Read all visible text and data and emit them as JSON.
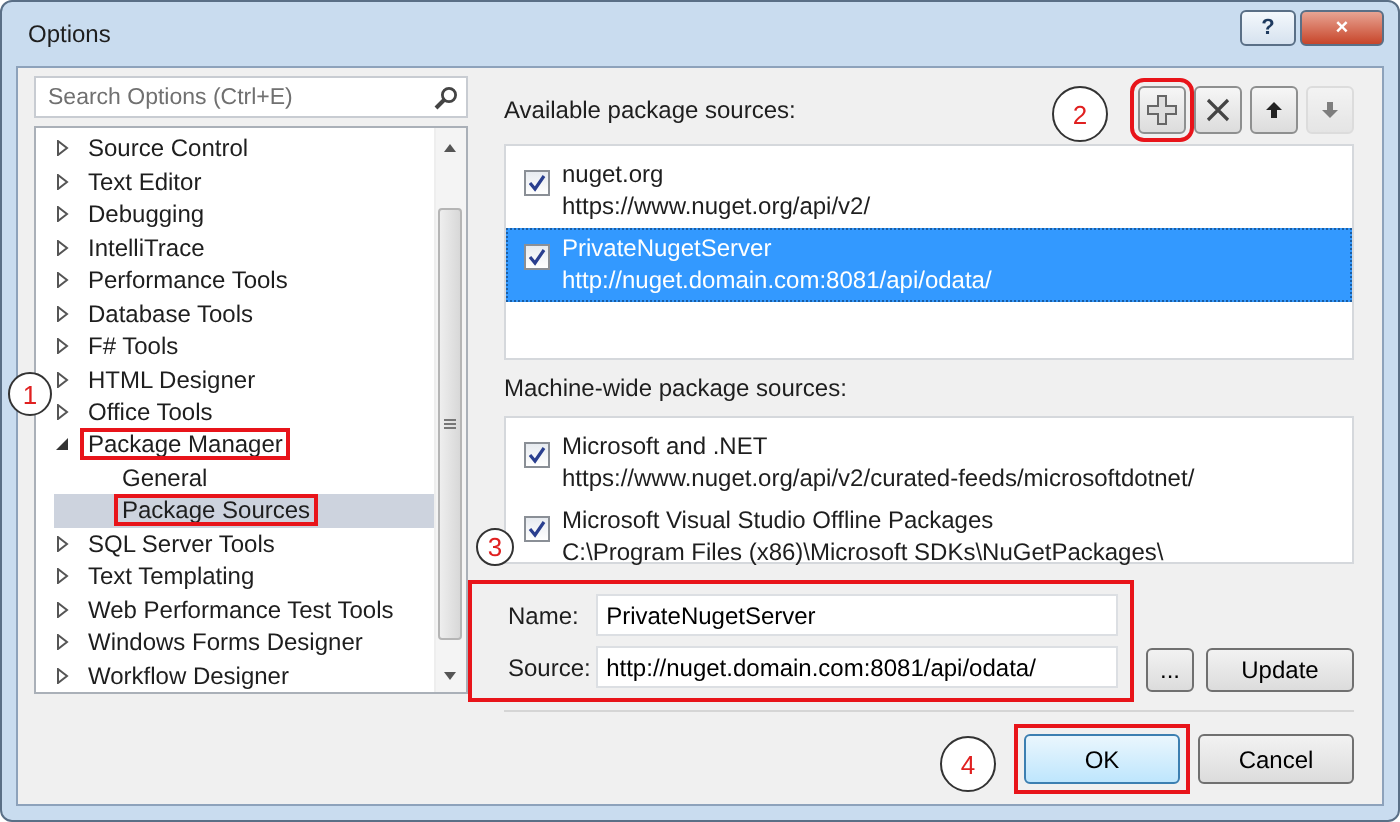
{
  "window": {
    "title": "Options",
    "buttons": [
      "?",
      "×"
    ]
  },
  "search": {
    "placeholder": "Search Options (Ctrl+E)"
  },
  "tree": [
    {
      "label": "Source Control",
      "expanded": false,
      "highlighted": false,
      "selected": false
    },
    {
      "label": "Text Editor",
      "expanded": false,
      "highlighted": false,
      "selected": false
    },
    {
      "label": "Debugging",
      "expanded": false,
      "highlighted": false,
      "selected": false
    },
    {
      "label": "IntelliTrace",
      "expanded": false,
      "highlighted": false,
      "selected": false
    },
    {
      "label": "Performance Tools",
      "expanded": false,
      "highlighted": false,
      "selected": false
    },
    {
      "label": "Database Tools",
      "expanded": false,
      "highlighted": false,
      "selected": false
    },
    {
      "label": "F# Tools",
      "expanded": false,
      "highlighted": false,
      "selected": false
    },
    {
      "label": "HTML Designer",
      "expanded": false,
      "highlighted": false,
      "selected": false
    },
    {
      "label": "Office Tools",
      "expanded": false,
      "highlighted": false,
      "selected": false
    },
    {
      "label": "Package Manager",
      "expanded": true,
      "highlighted": true,
      "selected": false,
      "children": [
        {
          "label": "General",
          "highlighted": false,
          "selected": false
        },
        {
          "label": "Package Sources",
          "highlighted": true,
          "selected": true
        }
      ]
    },
    {
      "label": "SQL Server Tools",
      "expanded": false,
      "highlighted": false,
      "selected": false
    },
    {
      "label": "Text Templating",
      "expanded": false,
      "highlighted": false,
      "selected": false
    },
    {
      "label": "Web Performance Test Tools",
      "expanded": false,
      "highlighted": false,
      "selected": false
    },
    {
      "label": "Windows Forms Designer",
      "expanded": false,
      "highlighted": false,
      "selected": false
    },
    {
      "label": "Workflow Designer",
      "expanded": false,
      "highlighted": false,
      "selected": false
    }
  ],
  "available": {
    "label": "Available package sources:",
    "toolbar": [
      {
        "kind": "add",
        "highlighted": true,
        "disabled": false
      },
      {
        "kind": "remove",
        "highlighted": false,
        "disabled": false
      },
      {
        "kind": "up",
        "highlighted": false,
        "disabled": false
      },
      {
        "kind": "down",
        "highlighted": false,
        "disabled": true
      }
    ],
    "sources": [
      {
        "name": "nuget.org",
        "url": "https://www.nuget.org/api/v2/",
        "checked": true,
        "selected": false
      },
      {
        "name": "PrivateNugetServer",
        "url": "http://nuget.domain.com:8081/api/odata/",
        "checked": true,
        "selected": true
      }
    ]
  },
  "machine_wide": {
    "label": "Machine-wide package sources:",
    "sources": [
      {
        "name": "Microsoft and .NET",
        "url": "https://www.nuget.org/api/v2/curated-feeds/microsoftdotnet/",
        "checked": true,
        "selected": false
      },
      {
        "name": "Microsoft Visual Studio Offline Packages",
        "url": "C:\\Program Files (x86)\\Microsoft SDKs\\NuGetPackages\\",
        "checked": true,
        "selected": false
      }
    ]
  },
  "form": {
    "highlighted": true,
    "name_label": "Name:",
    "name_value": "PrivateNugetServer",
    "source_label": "Source:",
    "source_value": "http://nuget.domain.com:8081/api/odata/",
    "browse": "...",
    "update": "Update"
  },
  "buttons": [
    {
      "label": "OK",
      "default": true,
      "highlighted": true
    },
    {
      "label": "Cancel",
      "default": false,
      "highlighted": false
    }
  ],
  "callouts": [
    "1",
    "2",
    "3",
    "4"
  ]
}
